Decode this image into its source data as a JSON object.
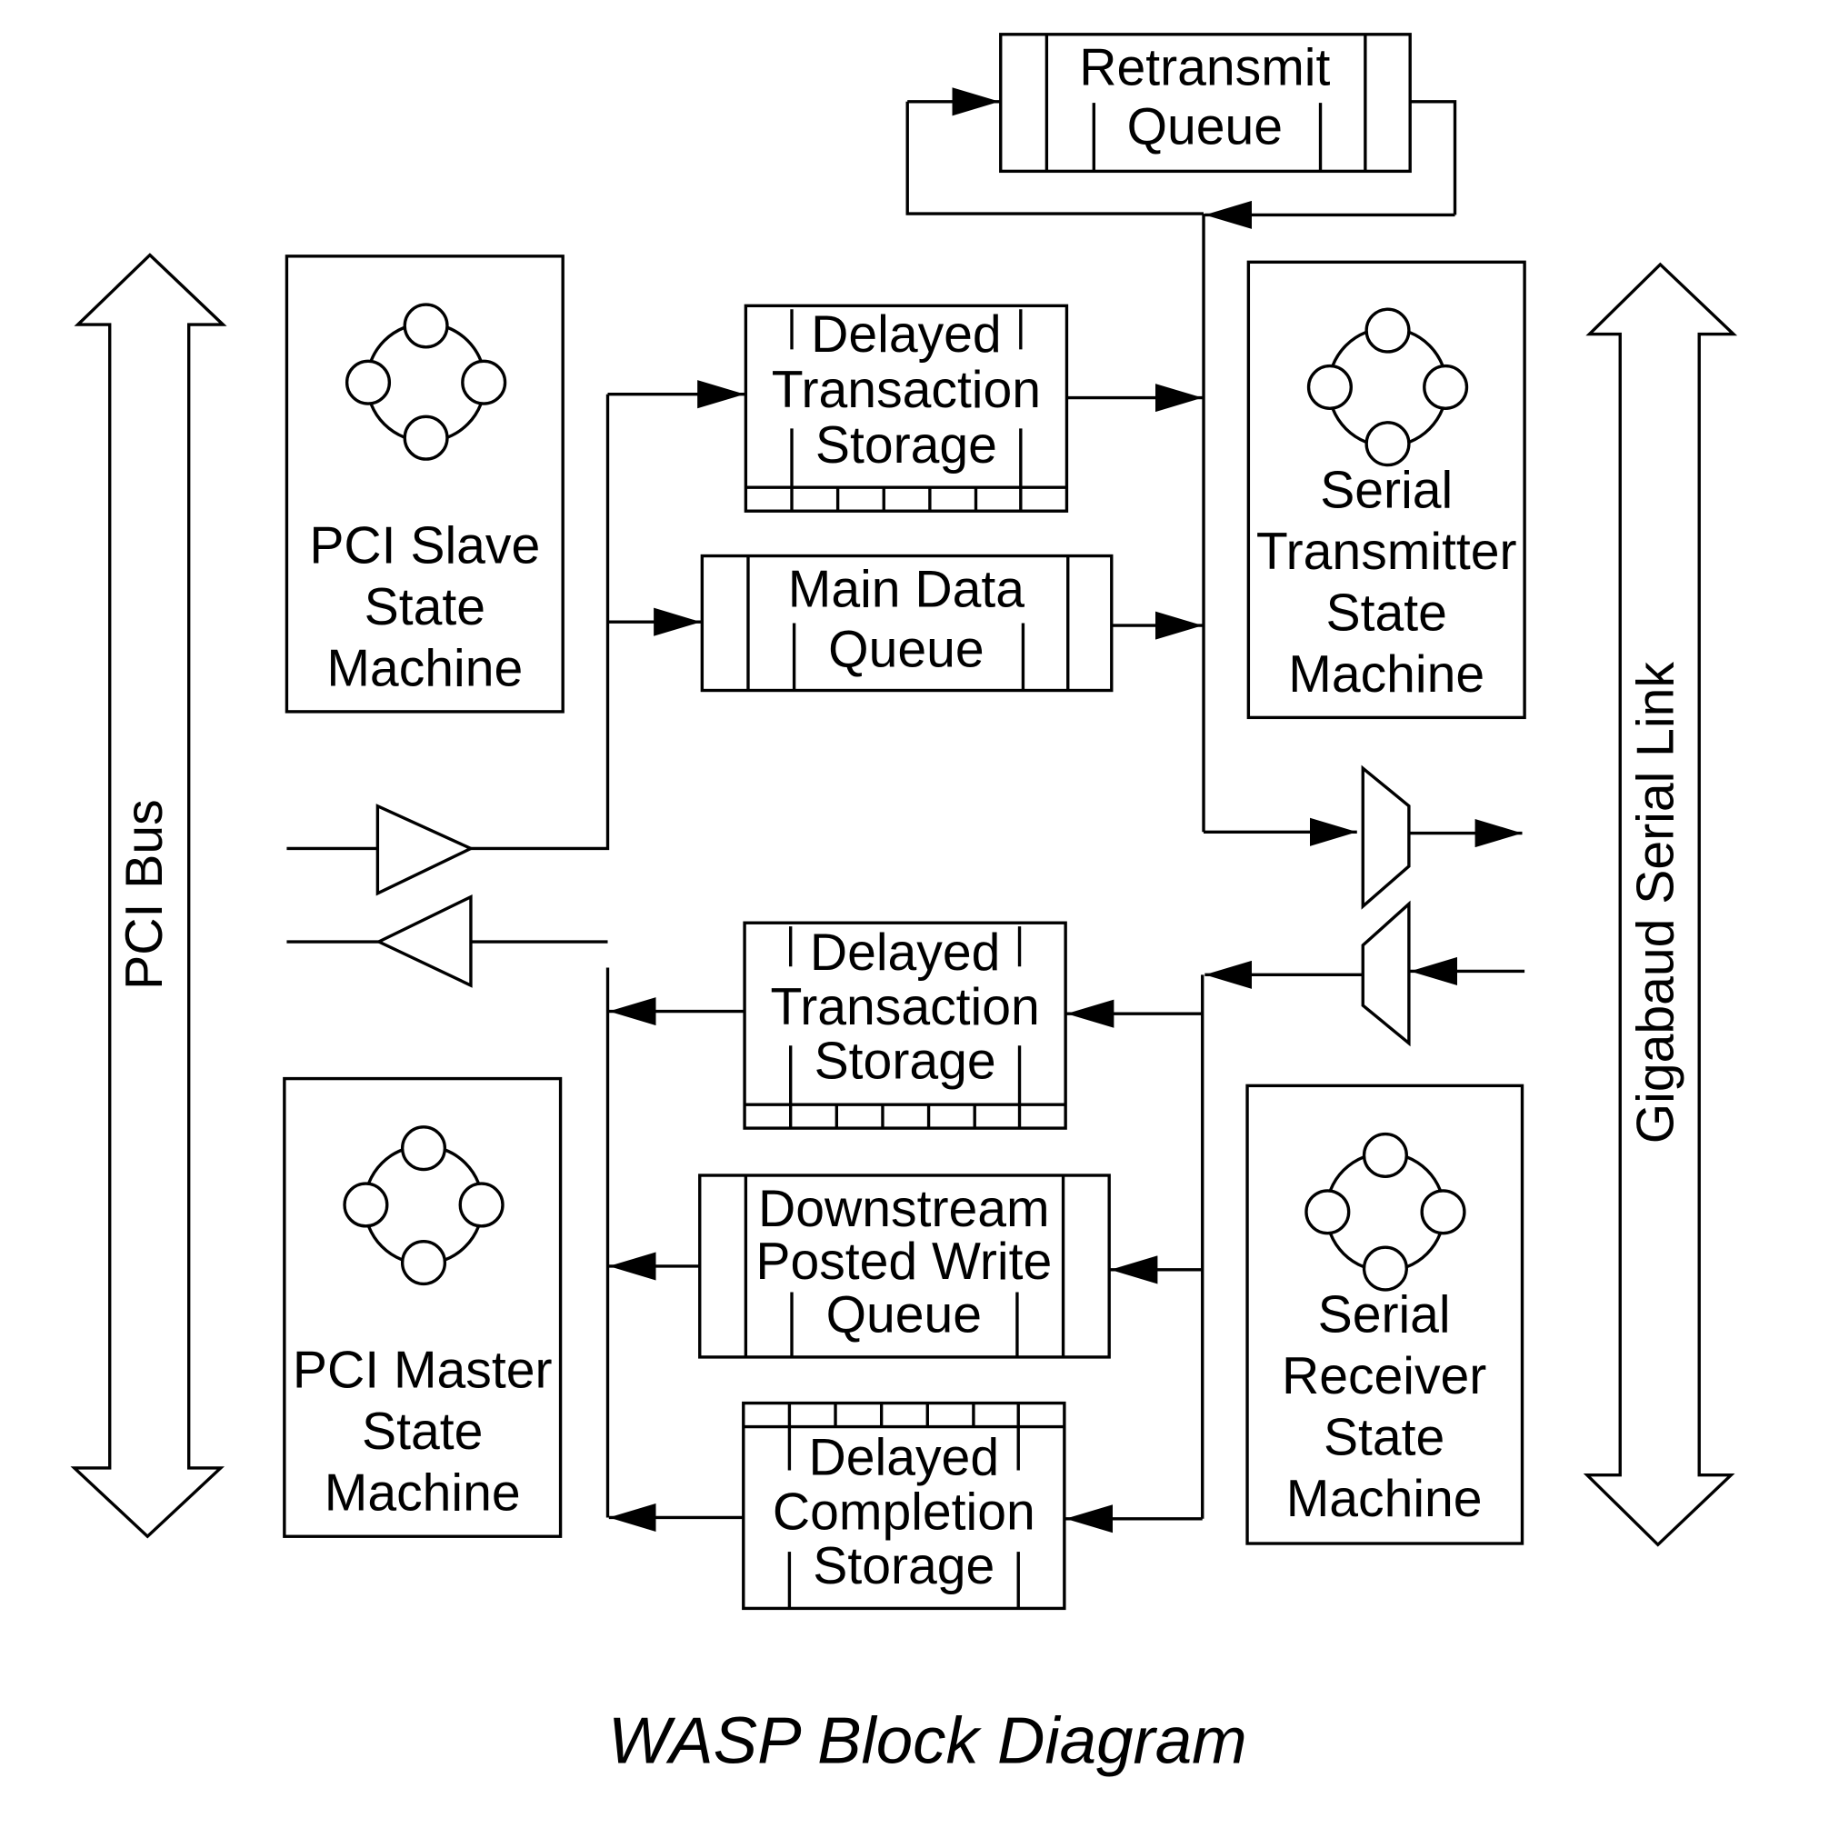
{
  "diagram": {
    "caption": "WASP Block Diagram",
    "buses": {
      "pci_bus": "PCI Bus",
      "serial_link": "Gigabaud Serial Link"
    },
    "state_machines": {
      "pci_slave": [
        "PCI Slave",
        "State",
        "Machine"
      ],
      "pci_master": [
        "PCI Master",
        "State",
        "Machine"
      ],
      "serial_tx": [
        "Serial",
        "Transmitter",
        "State",
        "Machine"
      ],
      "serial_rx": [
        "Serial",
        "Receiver",
        "State",
        "Machine"
      ]
    },
    "queues": {
      "retransmit": [
        "Retransmit",
        "Queue"
      ],
      "dts_upper": [
        "Delayed",
        "Transaction",
        "Storage"
      ],
      "main_data": [
        "Main Data",
        "Queue"
      ],
      "dts_lower": [
        "Delayed",
        "Transaction",
        "Storage"
      ],
      "downstream_pwq": [
        "Downstream",
        "Posted Write",
        "Queue"
      ],
      "delayed_completion": [
        "Delayed",
        "Completion",
        "Storage"
      ]
    },
    "colors": {
      "line": "#000000",
      "background": "#ffffff"
    }
  }
}
